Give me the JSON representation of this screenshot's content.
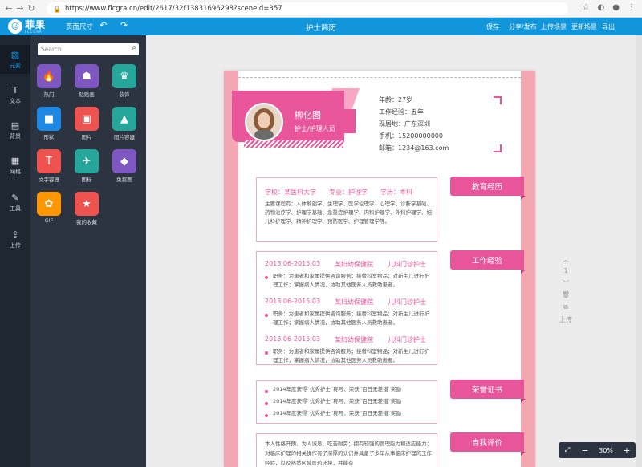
{
  "browser": {
    "url": "https://www.flcgra.cn/edit/2617/32f13831696298?sceneId=357",
    "back": "←",
    "forward": "→",
    "reload": "↻"
  },
  "topbar": {
    "logo_name": "菲果",
    "logo_sub": "FLCGRA",
    "page_size": "页面尺寸",
    "title": "护士简历",
    "actions": [
      "保存",
      "分享/发布",
      "上传场景",
      "更新场景",
      "导出"
    ]
  },
  "leftbar": [
    {
      "label": "元素",
      "icon": "image-icon",
      "glyph": "▨"
    },
    {
      "label": "文本",
      "icon": "text-icon",
      "glyph": "T"
    },
    {
      "label": "背景",
      "icon": "background-icon",
      "glyph": "▤"
    },
    {
      "label": "网格",
      "icon": "grid-icon",
      "glyph": "▦"
    },
    {
      "label": "工具",
      "icon": "tool-icon",
      "glyph": "✎"
    },
    {
      "label": "上传",
      "icon": "upload-icon",
      "glyph": "⇪"
    }
  ],
  "panel": {
    "search_placeholder": "Search",
    "items": [
      {
        "label": "热门",
        "color": "#7e57c2",
        "glyph": "🔥"
      },
      {
        "label": "贴贴画",
        "color": "#7e57c2",
        "glyph": "☗"
      },
      {
        "label": "装饰",
        "color": "#26a69a",
        "glyph": "♛"
      },
      {
        "label": "形状",
        "color": "#1e88e5",
        "glyph": "■"
      },
      {
        "label": "图片",
        "color": "#ef5350",
        "glyph": "▣"
      },
      {
        "label": "图片容器",
        "color": "#26a69a",
        "glyph": "▲"
      },
      {
        "label": "文字容器",
        "color": "#ef5350",
        "glyph": "T"
      },
      {
        "label": "图标",
        "color": "#26a69a",
        "glyph": "✈"
      },
      {
        "label": "免抠图",
        "color": "#7e57c2",
        "glyph": "◆"
      },
      {
        "label": "GIF",
        "color": "#ff9800",
        "glyph": "✿"
      },
      {
        "label": "我的收藏",
        "color": "#ef5350",
        "glyph": "★"
      }
    ]
  },
  "resume": {
    "name": "柳亿图",
    "role": "护士/护理人员",
    "info": [
      "年龄：27岁",
      "工作经验：五年",
      "现居地：广东深圳",
      "手机：15200000000",
      "邮箱：1234@163.com"
    ],
    "sections": {
      "education": {
        "tag": "教育经历",
        "school": "学校：某医科大学",
        "major": "专业：护理学",
        "degree": "学历：本科",
        "desc": "主要课程有：人体解剖学、生理学、医学伦理学、心理学、诊断学基础、药物治疗学、护理学基础、急重症护理学、内科护理学、外科护理学、妇儿科护理学、精神护理学、预防医学、护理管理学等。"
      },
      "work": {
        "tag": "工作经验",
        "entries": [
          {
            "date": "2013.06-2015.03",
            "org": "某妇幼保健院",
            "dept": "儿科门诊护士",
            "desc": "职务：为患者和家属提供咨询服务；接替科室物品；对新生儿进行护理工作；掌握病人情况，协助其他医务人员救助患者。"
          },
          {
            "date": "2013.06-2015.03",
            "org": "某妇幼保健院",
            "dept": "儿科门诊护士",
            "desc": "职务：为患者和家属提供咨询服务；接替科室物品；对新生儿进行护理工作；掌握病人情况，协助其他医务人员救助患者。"
          },
          {
            "date": "2013.06-2015.03",
            "org": "某妇幼保健院",
            "dept": "儿科门诊护士",
            "desc": "职务：为患者和家属提供咨询服务；接替科室物品；对新生儿进行护理工作；掌握病人情况，协助其他医务人员救助患者。"
          }
        ]
      },
      "honors": {
        "tag": "荣誉证书",
        "items": [
          "2014年度获得“优秀护士”称号、荣获”百日无差错“奖励",
          "2014年度获得“优秀护士”称号、荣获”百日无差错“奖励",
          "2014年度获得“优秀护士”称号、荣获”百日无差错“奖励"
        ]
      },
      "self": {
        "tag": "自我评价",
        "desc": "本人性格开朗、为人诚恳、吃苦耐劳；拥有较强的管理能力和适应能力；对临床护理的相关操作有了深厚的认识并具备了多年从事临床护理的工作经验，以及熟悉区域医药环境，并能有"
      }
    }
  },
  "right_controls": {
    "up": "︿",
    "page": "1",
    "down": "﹀",
    "delete": "🗑",
    "copy": "⧉",
    "upload": "上传"
  },
  "zoom": {
    "minus": "−",
    "value": "30%",
    "plus": "+",
    "fit": "⤢"
  }
}
